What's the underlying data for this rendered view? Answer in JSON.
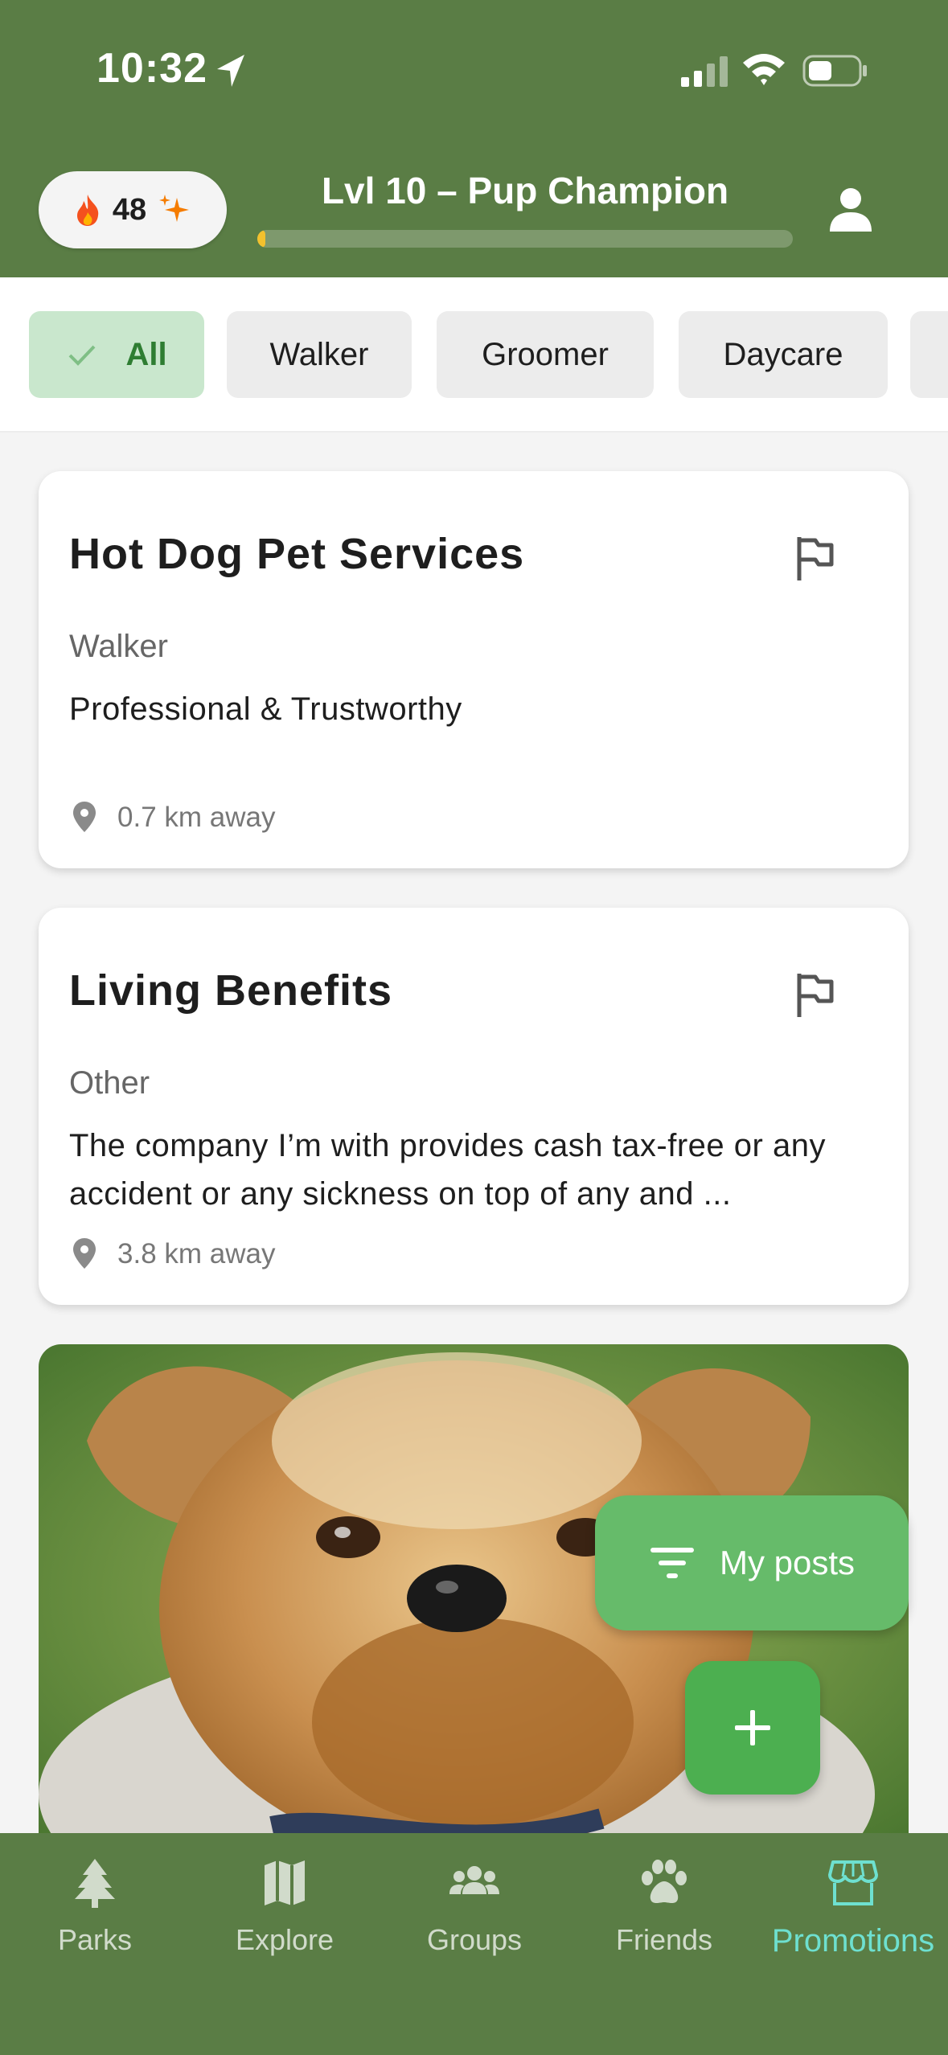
{
  "status_bar": {
    "time": "10:32"
  },
  "header": {
    "streak_count": "48",
    "level_title": "Lvl 10 – Pup Champion",
    "xp_progress": 0.015
  },
  "filters": {
    "chips": [
      "All",
      "Walker",
      "Groomer",
      "Daycare"
    ],
    "selected": "All"
  },
  "listings": [
    {
      "title": "Hot Dog Pet Services",
      "category": "Walker",
      "description": "Professional & Trustworthy",
      "distance": "0.7 km away"
    },
    {
      "title": "Living Benefits",
      "category": "Other",
      "description": "The company I’m with provides cash tax-free or any accident or any sickness on top of any and ...",
      "distance": "3.8 km away"
    }
  ],
  "actions": {
    "my_posts_label": "My posts"
  },
  "bottom_nav": {
    "items": [
      "Parks",
      "Explore",
      "Groups",
      "Friends",
      "Promotions"
    ],
    "active": "Promotions"
  },
  "colors": {
    "header_bg": "#5a7d45",
    "accent_green": "#4caf50",
    "chip_selected_bg": "#c9e7cd",
    "xp_fill": "#f2c12e",
    "nav_active": "#6ee0d0"
  },
  "icons": [
    "location-arrow-icon",
    "signal-icon",
    "wifi-icon",
    "battery-icon",
    "fire-icon",
    "sparkle-icon",
    "profile-icon",
    "check-icon",
    "flag-icon",
    "pin-icon",
    "filter-icon",
    "plus-icon",
    "tree-icon",
    "map-icon",
    "groups-icon",
    "paw-icon",
    "store-icon"
  ]
}
